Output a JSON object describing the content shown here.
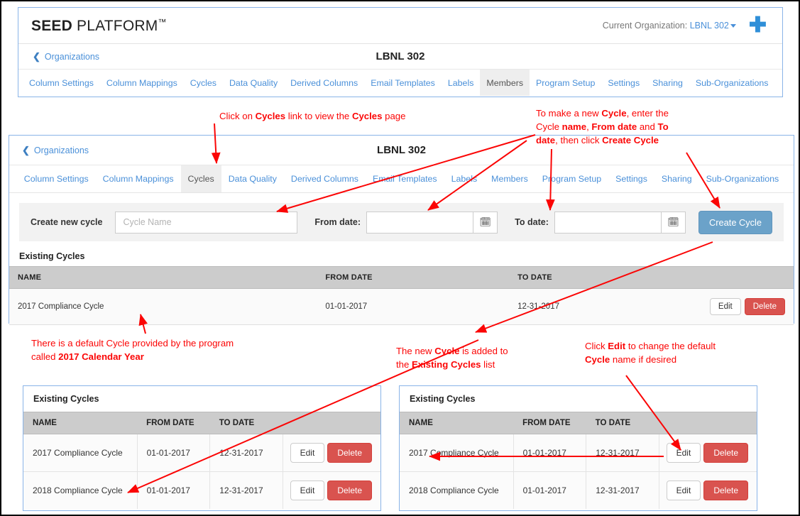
{
  "panel1": {
    "brand_bold": "SEED",
    "brand_light": " PLATFORM",
    "brand_tm": "™",
    "current_org_label": "Current Organization:",
    "current_org_value": "LBNL 302",
    "add_icon": "plus-icon",
    "back_link": "Organizations",
    "org_title": "LBNL 302",
    "tabs": [
      {
        "label": "Column Settings",
        "active": false
      },
      {
        "label": "Column Mappings",
        "active": false
      },
      {
        "label": "Cycles",
        "active": false
      },
      {
        "label": "Data Quality",
        "active": false
      },
      {
        "label": "Derived Columns",
        "active": false
      },
      {
        "label": "Email Templates",
        "active": false
      },
      {
        "label": "Labels",
        "active": false
      },
      {
        "label": "Members",
        "active": true
      },
      {
        "label": "Program Setup",
        "active": false
      },
      {
        "label": "Settings",
        "active": false
      },
      {
        "label": "Sharing",
        "active": false
      },
      {
        "label": "Sub-Organizations",
        "active": false
      }
    ]
  },
  "panel2": {
    "back_link": "Organizations",
    "org_title": "LBNL 302",
    "tabs": [
      {
        "label": "Column Settings",
        "active": false
      },
      {
        "label": "Column Mappings",
        "active": false
      },
      {
        "label": "Cycles",
        "active": true
      },
      {
        "label": "Data Quality",
        "active": false
      },
      {
        "label": "Derived Columns",
        "active": false
      },
      {
        "label": "Email Templates",
        "active": false
      },
      {
        "label": "Labels",
        "active": false
      },
      {
        "label": "Members",
        "active": false
      },
      {
        "label": "Program Setup",
        "active": false
      },
      {
        "label": "Settings",
        "active": false
      },
      {
        "label": "Sharing",
        "active": false
      },
      {
        "label": "Sub-Organizations",
        "active": false
      }
    ],
    "form": {
      "create_label": "Create new cycle",
      "name_placeholder": "Cycle Name",
      "name_value": "",
      "from_label": "From date:",
      "from_value": "",
      "to_label": "To date:",
      "to_value": "",
      "calendar_icon": "calendar-icon",
      "create_button": "Create Cycle"
    },
    "existing_title": "Existing Cycles",
    "table": {
      "columns": [
        "NAME",
        "FROM DATE",
        "TO DATE",
        ""
      ],
      "rows": [
        {
          "name": "2017 Compliance Cycle",
          "from": "01-01-2017",
          "to": "12-31-2017",
          "edit": "Edit",
          "delete": "Delete"
        }
      ]
    }
  },
  "mini_left": {
    "title": "Existing Cycles",
    "columns": [
      "NAME",
      "FROM DATE",
      "TO DATE",
      ""
    ],
    "rows": [
      {
        "name": "2017 Compliance Cycle",
        "from": "01-01-2017",
        "to": "12-31-2017",
        "edit": "Edit",
        "delete": "Delete"
      },
      {
        "name": "2018 Compliance Cycle",
        "from": "01-01-2017",
        "to": "12-31-2017",
        "edit": "Edit",
        "delete": "Delete"
      }
    ]
  },
  "mini_right": {
    "title": "Existing Cycles",
    "columns": [
      "NAME",
      "FROM DATE",
      "TO DATE",
      ""
    ],
    "rows": [
      {
        "name": "2017 Compliance Cycle",
        "from": "01-01-2017",
        "to": "12-31-2017",
        "edit": "Edit",
        "delete": "Delete"
      },
      {
        "name": "2018 Compliance Cycle",
        "from": "01-01-2017",
        "to": "12-31-2017",
        "edit": "Edit",
        "delete": "Delete"
      }
    ]
  },
  "annotations": {
    "a1_pre": "Click on ",
    "a1_b1": "Cycles",
    "a1_mid": " link to view the ",
    "a1_b2": "Cycles",
    "a1_post": " page",
    "a2_l1_pre": "To make a new ",
    "a2_l1_b": "Cycle",
    "a2_l1_post": ", enter the",
    "a2_l2_pre": "Cycle ",
    "a2_l2_b1": "name",
    "a2_l2_mid": ", ",
    "a2_l2_b2": "From date",
    "a2_l2_post": " and ",
    "a2_l2_b3": "To",
    "a2_l3_b1": "date",
    "a2_l3_mid": ", then click ",
    "a2_l3_b2": "Create Cycle",
    "a3_l1": "There is a default Cycle provided by the program",
    "a3_l2_pre": "called ",
    "a3_l2_b": "2017 Calendar Year",
    "a4_l1_pre": "The new ",
    "a4_l1_b": "Cycle",
    "a4_l1_post": " is added to",
    "a4_l2_pre": "the ",
    "a4_l2_b": "Existing Cycles",
    "a4_l2_post": " list",
    "a5_l1_pre": "Click ",
    "a5_l1_b": "Edit",
    "a5_l1_post": " to change the default",
    "a5_l2_b": "Cycle",
    "a5_l2_post": " name if desired"
  },
  "colors": {
    "accent_blue": "#4a90d9",
    "panel_border": "#8ab4e8",
    "annotation_red": "#fb0505",
    "delete_red": "#d9534f",
    "create_blue": "#6ba2c9",
    "table_header_gray": "#cccccc"
  }
}
